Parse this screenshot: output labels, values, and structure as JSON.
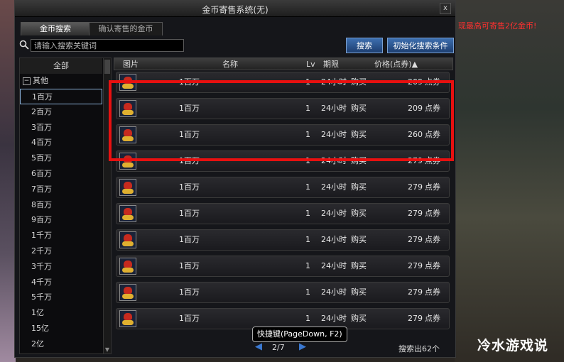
{
  "window": {
    "title": "金币寄售系统(无)",
    "close": "x"
  },
  "tabs": [
    "金币搜索",
    "确认寄售的金币"
  ],
  "search": {
    "placeholder": "请输入搜索关键词",
    "button": "搜索",
    "reset_button": "初始化搜索条件"
  },
  "notice": "现最高可寄售2亿金币!",
  "sidebar": {
    "all": "全部",
    "group": "其他",
    "group_toggle": "−",
    "items": [
      "1百万",
      "2百万",
      "3百万",
      "4百万",
      "5百万",
      "6百万",
      "7百万",
      "8百万",
      "9百万",
      "1千万",
      "2千万",
      "3千万",
      "4千万",
      "5千万",
      "1亿",
      "15亿",
      "2亿"
    ],
    "selected_index": 0
  },
  "table": {
    "headers": {
      "image": "图片",
      "name": "名称",
      "level": "Lv",
      "duration": "期限",
      "price": "价格(点券)▲"
    },
    "rows": [
      {
        "name": "1百万",
        "level": "1",
        "duration": "24小时",
        "action": "购买",
        "price": "209",
        "unit": "点券"
      },
      {
        "name": "1百万",
        "level": "1",
        "duration": "24小时",
        "action": "购买",
        "price": "209",
        "unit": "点券"
      },
      {
        "name": "1百万",
        "level": "1",
        "duration": "24小时",
        "action": "购买",
        "price": "260",
        "unit": "点券"
      },
      {
        "name": "1百万",
        "level": "1",
        "duration": "24小时",
        "action": "购买",
        "price": "279",
        "unit": "点券"
      },
      {
        "name": "1百万",
        "level": "1",
        "duration": "24小时",
        "action": "购买",
        "price": "279",
        "unit": "点券"
      },
      {
        "name": "1百万",
        "level": "1",
        "duration": "24小时",
        "action": "购买",
        "price": "279",
        "unit": "点券"
      },
      {
        "name": "1百万",
        "level": "1",
        "duration": "24小时",
        "action": "购买",
        "price": "279",
        "unit": "点券"
      },
      {
        "name": "1百万",
        "level": "1",
        "duration": "24小时",
        "action": "购买",
        "price": "279",
        "unit": "点券"
      },
      {
        "name": "1百万",
        "level": "1",
        "duration": "24小时",
        "action": "购买",
        "price": "279",
        "unit": "点券"
      },
      {
        "name": "1百万",
        "level": "1",
        "duration": "24小时",
        "action": "购买",
        "price": "279",
        "unit": "点券"
      }
    ]
  },
  "pager": {
    "text": "2/7",
    "prev": "◀",
    "next": "▶",
    "tooltip": "快捷键(PageDown, F2)"
  },
  "result_count": "搜索出62个",
  "watermark": "冷水游戏说",
  "icons": {
    "search": "search-icon",
    "item": "gold-sack-icon"
  },
  "colors": {
    "highlight": "#e81010",
    "notice": "#ff3030",
    "button": "#2a5a9a"
  }
}
